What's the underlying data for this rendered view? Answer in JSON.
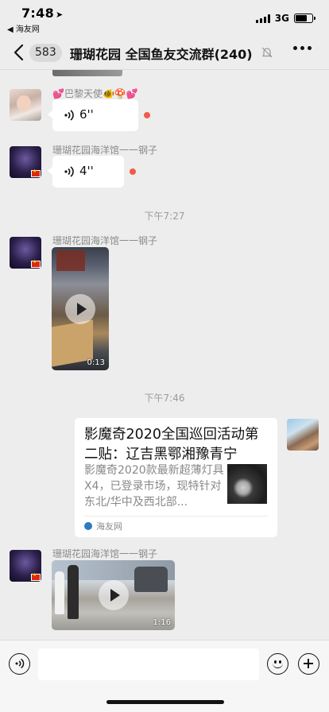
{
  "status_bar": {
    "time": "7:48",
    "back_app": "◀ 海友网",
    "network": "3G",
    "battery_level": 0.7
  },
  "nav": {
    "unread_count": "583",
    "title": "珊瑚花园 全国鱼友交流群(240)"
  },
  "messages": [
    {
      "type": "voice",
      "sender": "💕巴黎天使🐠🍄💕",
      "duration": "6''",
      "unread": true
    },
    {
      "type": "voice",
      "sender": "珊瑚花园海洋馆一一钢子",
      "duration": "4''",
      "unread": true
    },
    {
      "type": "time",
      "text": "下午7:27"
    },
    {
      "type": "video",
      "sender": "珊瑚花园海洋馆一一钢子",
      "duration": "0:13"
    },
    {
      "type": "time",
      "text": "下午7:46"
    },
    {
      "type": "link",
      "self": true,
      "title": "影魔奇2020全国巡回活动第二贴：辽吉黑鄂湘豫青宁",
      "description": "影魔奇2020款最新超薄灯具X4，已登录市场，现特针对东北/华中及西北部...",
      "source": "海友网"
    },
    {
      "type": "video",
      "sender": "珊瑚花园海洋馆一一钢子",
      "duration": "1:16"
    }
  ],
  "input": {
    "placeholder": ""
  }
}
